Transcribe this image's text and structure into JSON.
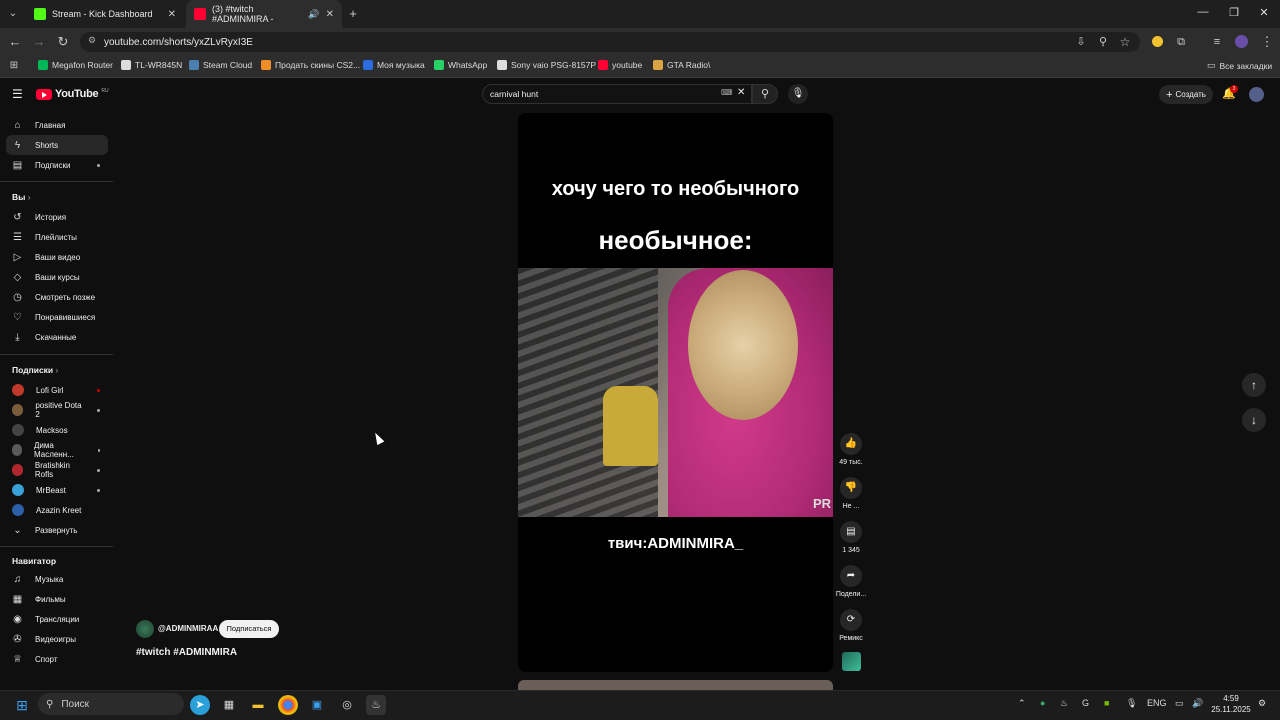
{
  "browser": {
    "tabs": [
      {
        "title": "Stream - Kick Dashboard",
        "favicon_color": "#53fc18"
      },
      {
        "title": "(3) #twitch #ADMINMIRA -",
        "favicon_color": "#ff0033"
      }
    ],
    "url": "youtube.com/shorts/yxZLvRyxI3E",
    "bookmarks": [
      {
        "label": "Megafon Router",
        "color": "#00b956"
      },
      {
        "label": "TL-WR845N",
        "color": "#dddddd"
      },
      {
        "label": "Steam Cloud",
        "color": "#4a7fb0"
      },
      {
        "label": "Продать скины CS2...",
        "color": "#f28c28"
      },
      {
        "label": "Моя музыка",
        "color": "#2d6cdf"
      },
      {
        "label": "WhatsApp",
        "color": "#25d366"
      },
      {
        "label": "Sony vaio PSG-8157P",
        "color": "#dddddd"
      },
      {
        "label": "youtube",
        "color": "#ff0033"
      },
      {
        "label": "GTA Radio\\",
        "color": "#d9a441"
      }
    ],
    "all_bookmarks": "Все закладки"
  },
  "youtube": {
    "logo": "YouTube",
    "logo_region": "RU",
    "search_value": "carnival hunt",
    "create_label": "Создать",
    "notif_count": "3"
  },
  "sidebar": {
    "main": [
      {
        "label": "Главная",
        "icon": "⌂"
      },
      {
        "label": "Shorts",
        "icon": "ϟ"
      },
      {
        "label": "Подписки",
        "icon": "▤"
      }
    ],
    "you_header": "Вы",
    "you": [
      {
        "label": "История",
        "icon": "↺"
      },
      {
        "label": "Плейлисты",
        "icon": "☰"
      },
      {
        "label": "Ваши видео",
        "icon": "▷"
      },
      {
        "label": "Ваши курсы",
        "icon": "◇"
      },
      {
        "label": "Смотреть позже",
        "icon": "◷"
      },
      {
        "label": "Понравившиеся",
        "icon": "👍"
      },
      {
        "label": "Скачанные",
        "icon": "⤓"
      }
    ],
    "subs_header": "Подписки",
    "subs": [
      {
        "label": "Lofi Girl",
        "color": "#c0392b"
      },
      {
        "label": "positive Dota 2",
        "color": "#7a5c3a"
      },
      {
        "label": "Macksos",
        "color": "#444444"
      },
      {
        "label": "Дима Масленн...",
        "color": "#5a5a5a"
      },
      {
        "label": "Bratishkin Rofls",
        "color": "#b0282e"
      },
      {
        "label": "MrBeast",
        "color": "#3aa0d8"
      },
      {
        "label": "Azazin Kreet",
        "color": "#2b5fa8"
      }
    ],
    "expand_label": "Развернуть",
    "nav_header": "Навигатор",
    "nav": [
      {
        "label": "Музыка",
        "icon": "♫"
      },
      {
        "label": "Фильмы",
        "icon": "▦"
      },
      {
        "label": "Трансляции",
        "icon": "◉"
      },
      {
        "label": "Видеоигры",
        "icon": "✇"
      },
      {
        "label": "Спорт",
        "icon": "🏆"
      }
    ]
  },
  "short": {
    "caption_top": "хочу чего то необычного",
    "caption_mid": "необычное:",
    "caption_bottom": "твич:ADMINMIRA_",
    "watermark": "PR",
    "channel": "@ADMINMIRAA",
    "subscribe_label": "Подписаться",
    "title": "#twitch #ADMINMIRA",
    "actions": {
      "likes": "49 тыс.",
      "dislike": "Не ...",
      "comments": "1 345",
      "share": "Подели...",
      "remix": "Ремикс"
    }
  },
  "taskbar": {
    "search_placeholder": "Поиск",
    "lang": "ENG",
    "time": "4:59",
    "date": "25.11.2025"
  }
}
